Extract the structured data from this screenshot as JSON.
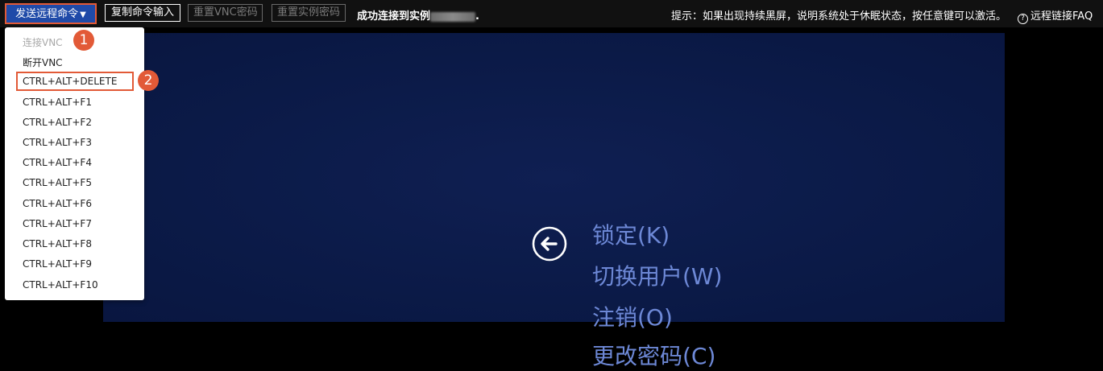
{
  "toolbar": {
    "send_remote_command": "发送远程命令",
    "copy_command_input": "复制命令输入",
    "reset_vnc_password": "重置VNC密码",
    "reset_instance_password": "重置实例密码",
    "status_prefix": "成功连接到实例",
    "status_suffix": ".",
    "hint": "提示：如果出现持续黑屏，说明系统处于休眠状态，按任意键可以激活。",
    "faq": "远程链接FAQ"
  },
  "menu": {
    "items": [
      {
        "label": "连接VNC",
        "disabled": true
      },
      {
        "label": "断开VNC"
      },
      {
        "label": "CTRL+ALT+DELETE"
      },
      {
        "label": "CTRL+ALT+F1"
      },
      {
        "label": "CTRL+ALT+F2"
      },
      {
        "label": "CTRL+ALT+F3"
      },
      {
        "label": "CTRL+ALT+F4"
      },
      {
        "label": "CTRL+ALT+F5"
      },
      {
        "label": "CTRL+ALT+F6"
      },
      {
        "label": "CTRL+ALT+F7"
      },
      {
        "label": "CTRL+ALT+F8"
      },
      {
        "label": "CTRL+ALT+F9"
      },
      {
        "label": "CTRL+ALT+F10"
      }
    ]
  },
  "annotations": {
    "marker1": "1",
    "marker2": "2"
  },
  "remote_screen": {
    "options": {
      "lock": "锁定(K)",
      "switch_user": "切换用户(W)",
      "logout": "注销(O)",
      "change_password": "更改密码(C)"
    }
  },
  "colors": {
    "accent_button": "#1f4aa8",
    "annotation_red": "#e25a37",
    "remote_background": "#0b1a47",
    "remote_text": "#6d88d6"
  }
}
